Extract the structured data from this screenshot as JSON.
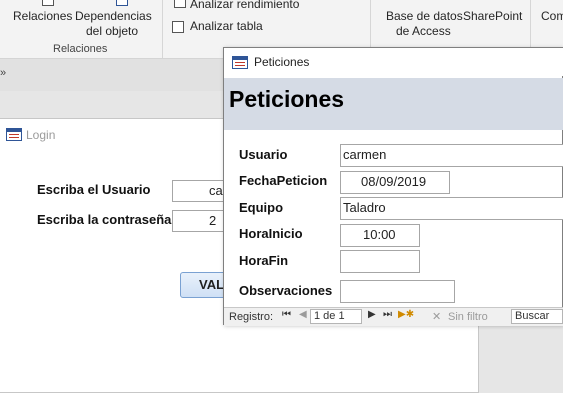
{
  "ribbon": {
    "relaciones": "Relaciones",
    "dependencias_line1": "Dependencias",
    "dependencias_line2": "del objeto",
    "group_relaciones": "Relaciones",
    "analizar_rendimiento": "Analizar rendimiento",
    "analizar_tabla": "Analizar tabla",
    "base_datos_line1": "Base de datos",
    "base_datos_line2": "de Access",
    "sharepoint": "SharePoint",
    "com_truncated": "Com"
  },
  "login_form": {
    "title": "Login",
    "usuario_label": "Escriba el Usuario",
    "usuario_value": "car",
    "password_label": "Escriba la contraseña",
    "password_value": "2",
    "button_label": "VAL"
  },
  "peticiones_form": {
    "window_title": "Peticiones",
    "heading": "Peticiones",
    "fields": {
      "usuario_label": "Usuario",
      "usuario_value": "carmen",
      "fecha_label": "FechaPeticion",
      "fecha_value": "08/09/2019",
      "equipo_label": "Equipo",
      "equipo_value": "Taladro",
      "horainicio_label": "HoraInicio",
      "horainicio_value": "10:00",
      "horafin_label": "HoraFin",
      "horafin_value": "",
      "observaciones_label": "Observaciones",
      "observaciones_value": ""
    },
    "status_bar": {
      "registro_label": "Registro:",
      "record_position": "1 de 1",
      "filter_label": "Sin filtro",
      "search_placeholder": "Buscar"
    }
  },
  "colors": {
    "form_header_bg": "#d5dbe5",
    "access_icon": "#2f5597",
    "button_border": "#7aa1d2"
  }
}
